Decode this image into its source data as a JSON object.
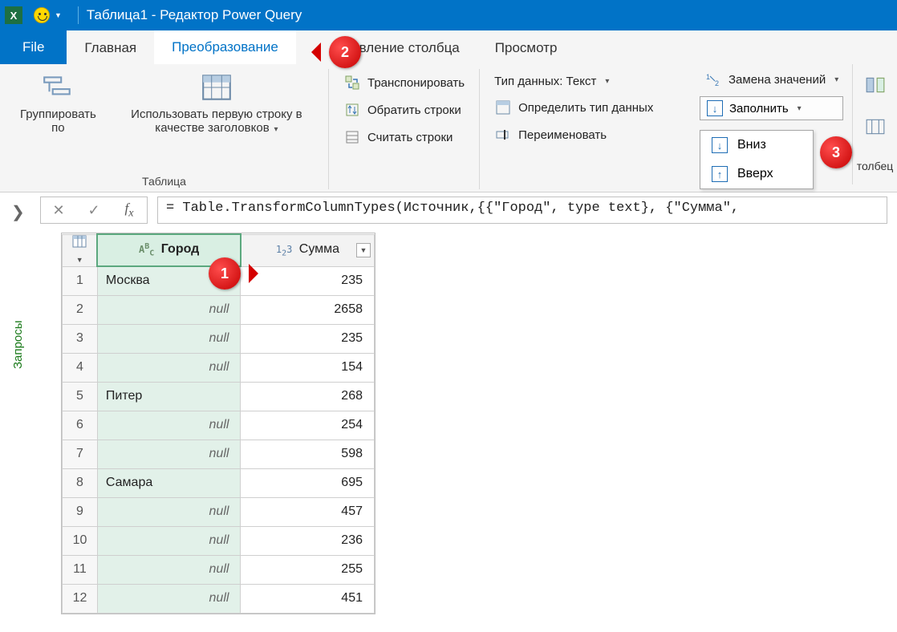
{
  "titlebar": {
    "title": "Таблица1 - Редактор Power Query"
  },
  "tabs": {
    "file": "File",
    "home": "Главная",
    "transform": "Преобразование",
    "addcolumn": "бавление столбца",
    "view": "Просмотр"
  },
  "ribbon": {
    "group_table_label": "Таблица",
    "groupby": "Группировать по",
    "use_first_row": "Использовать первую строку в качестве заголовков",
    "transpose": "Транспонировать",
    "reverse_rows": "Обратить строки",
    "count_rows": "Считать строки",
    "datatype": "Тип данных: Текст",
    "detect_type": "Определить тип данных",
    "rename": "Переименовать",
    "replace_values": "Замена значений",
    "fill": "Заполнить",
    "fill_down": "Вниз",
    "fill_up": "Вверх",
    "column_clip": "толбец"
  },
  "formula": "= Table.TransformColumnTypes(Источник,{{\"Город\", type text}, {\"Сумма\",",
  "sidebar": "Запросы",
  "table": {
    "col_city": "Город",
    "col_sum": "Сумма",
    "rows": [
      {
        "n": 1,
        "city": "Москва",
        "null": false,
        "sum": "235"
      },
      {
        "n": 2,
        "city": "null",
        "null": true,
        "sum": "2658"
      },
      {
        "n": 3,
        "city": "null",
        "null": true,
        "sum": "235"
      },
      {
        "n": 4,
        "city": "null",
        "null": true,
        "sum": "154"
      },
      {
        "n": 5,
        "city": "Питер",
        "null": false,
        "sum": "268"
      },
      {
        "n": 6,
        "city": "null",
        "null": true,
        "sum": "254"
      },
      {
        "n": 7,
        "city": "null",
        "null": true,
        "sum": "598"
      },
      {
        "n": 8,
        "city": "Самара",
        "null": false,
        "sum": "695"
      },
      {
        "n": 9,
        "city": "null",
        "null": true,
        "sum": "457"
      },
      {
        "n": 10,
        "city": "null",
        "null": true,
        "sum": "236"
      },
      {
        "n": 11,
        "city": "null",
        "null": true,
        "sum": "255"
      },
      {
        "n": 12,
        "city": "null",
        "null": true,
        "sum": "451"
      }
    ]
  },
  "callouts": {
    "c1": "1",
    "c2": "2",
    "c3": "3"
  }
}
